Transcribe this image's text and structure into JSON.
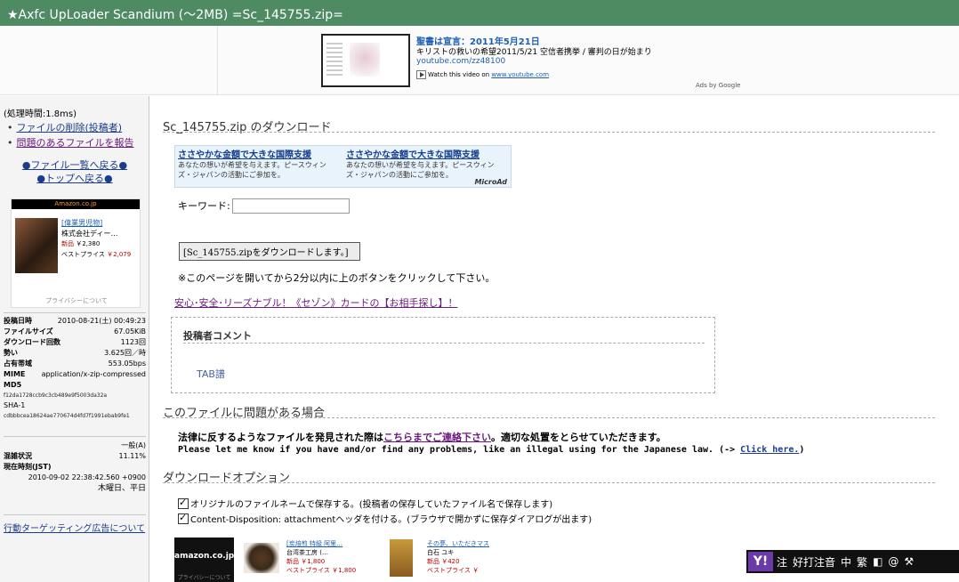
{
  "title": "★Axfc UpLoader Scandium (～2MB) =Sc_145755.zip=",
  "video_ad": {
    "title": "聖書は宣言：2011年5月21日",
    "desc": "キリストの救いの希望2011/5/21 空信者携挙 / 審判の日が始まり",
    "url": "youtube.com/zz48100",
    "watch_prefix": "Watch this video on ",
    "watch_link": "www.youtube.com",
    "ads_by": "Ads by Google"
  },
  "sidebar": {
    "processing": "(処理時間:1.8ms)",
    "links": [
      "ファイルの削除(投稿者)",
      "問題のあるファイルを報告"
    ],
    "nav": [
      "●ファイル一覧へ戻る●",
      "●トップへ戻る●"
    ],
    "amazon": {
      "header": "Amazon.co.jp",
      "title": "[偉業男児物]",
      "publisher": "株式会社ディー…",
      "new_label": "新品",
      "new_price": "￥2,380",
      "best_label": "ベストプライス",
      "best_price": "￥2,079",
      "privacy": "プライバシーについて"
    },
    "stats": [
      {
        "label": "投稿日時",
        "value": "2010-08-21(土) 00:49:23"
      },
      {
        "label": "ファイルサイズ",
        "value": "67.05KiB"
      },
      {
        "label": "ダウンロード回数",
        "value": "1123回"
      },
      {
        "label": "勢い",
        "value": "3.625回／時"
      },
      {
        "label": "占有帯域",
        "value": "553.05bps"
      },
      {
        "label": "MIME",
        "value": "application/x-zip-compressed"
      }
    ],
    "md5_label": "MD5",
    "md5": "f12da1728ccb9c3cb489e9f5003da32a",
    "sha1_label": "SHA-1",
    "sha1": "cdbbbcea18624ae770674d4fd7f1991ebab9fe1",
    "status_general": "一般(A)",
    "status": [
      {
        "label": "混雑状況",
        "value": "11.11%"
      },
      {
        "label": "現在時刻(JST)",
        "value": ""
      }
    ],
    "now": "2010-09-02 22:38:42.560 +0900",
    "day": "木曜日、平日",
    "behavior_ads": "行動ターゲッティング広告について"
  },
  "main": {
    "heading": "Sc_145755.zip のダウンロード",
    "microad": {
      "ads": [
        {
          "title": "ささやかな金額で大きな国際支援",
          "desc": "あなたの想いが希望を与えます。ピースウィンズ・ジャパンの活動にご参加を。"
        },
        {
          "title": "ささやかな金額で大きな国際支援",
          "desc": "あなたの想いが希望を与えます。ピースウィンズ・ジャパンの活動にご参加を。"
        }
      ],
      "logo": "MicroAd"
    },
    "keyword_label": "キーワード:",
    "keyword_value": "",
    "download_button": "[Sc_145755.zipをダウンロードします。]",
    "note": "※このページを開いてから2分以内に上のボタンをクリックして下さい。",
    "promo": "安心･安全･リーズナブル！《セゾン》カードの【お相手探し】！",
    "comment_heading": "投稿者コメント",
    "comment": "TAB譜",
    "problem_heading": "このファイルに問題がある場合",
    "problem_text_1": "法律に反するようなファイルを発見された際は",
    "problem_link": "こちらまでご連絡下さい",
    "problem_text_2": "。適切な処置をとらせていただきます。",
    "problem_en_1": "Please let me know if you have and/or find any problems, like an illegal using for the Japanese law. (-> ",
    "problem_en_link": "Click here.",
    "problem_en_2": ")",
    "options_heading": "ダウンロードオプション",
    "options": [
      {
        "label": "オリジナルのファイルネームで保存する。(投稿者の保存していたファイル名で保存します)",
        "checked": true
      },
      {
        "label": "Content-Disposition: attachmentヘッダを付ける。(ブラウザで開かずに保存ダイアログが出ます)",
        "checked": true
      }
    ],
    "amazon_bar": {
      "logo": "amazon.co.jp",
      "privacy": "プライバシーについて",
      "items": [
        {
          "title": "[炭焙煎 特級 阿里…",
          "maker": "台湾茶工房 (…",
          "new": "新品 ￥1,800",
          "best": "ベストプライス ￥1,800"
        },
        {
          "title": "その夢、いただきマス",
          "maker": "白石 ユキ",
          "new": "新品 ￥420",
          "best": "ベストプライス ￥"
        }
      ]
    }
  },
  "ime": {
    "logo": "Y!",
    "items": [
      "注",
      "好打注音",
      "中",
      "繁",
      "◧",
      "@",
      "⚒"
    ]
  }
}
